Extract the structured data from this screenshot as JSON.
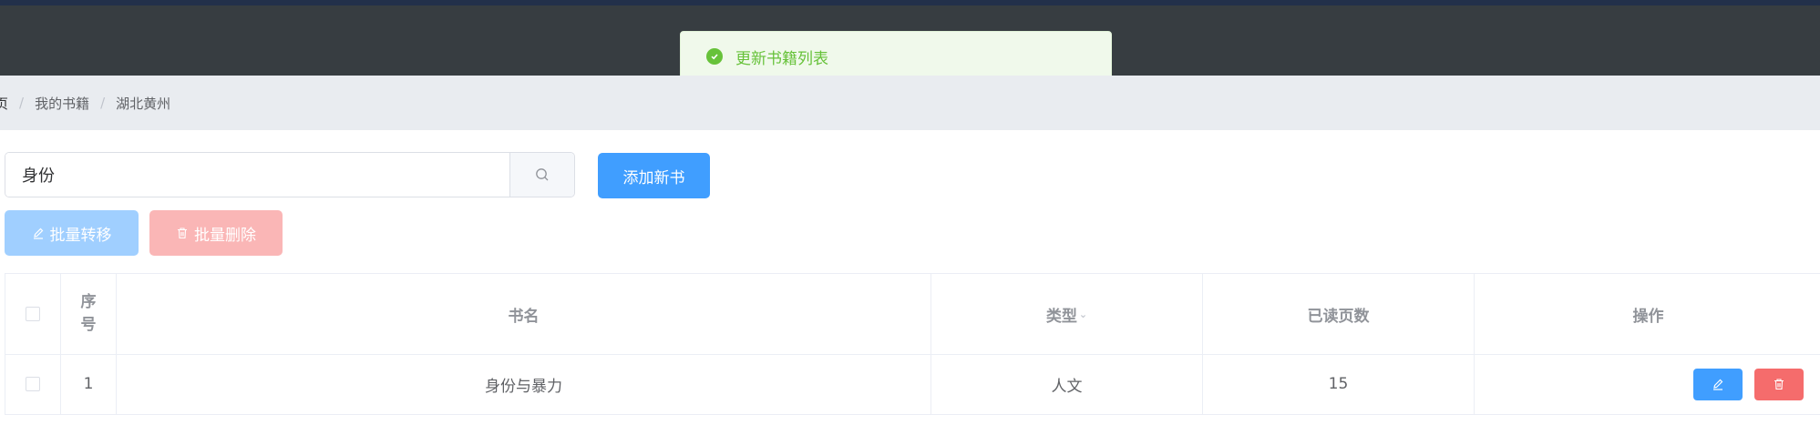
{
  "toast": {
    "message": "更新书籍列表",
    "icon": "check-circle-icon"
  },
  "breadcrumb": {
    "items": [
      "页",
      "我的书籍",
      "湖北黄州"
    ],
    "separator": "/"
  },
  "search": {
    "value": "身份",
    "icon": "search-icon"
  },
  "buttons": {
    "add": "添加新书",
    "batch_move": "批量转移",
    "batch_delete": "批量删除"
  },
  "table": {
    "headers": {
      "index_line1": "序",
      "index_line2": "号",
      "title": "书名",
      "type": "类型",
      "pages_read": "已读页数",
      "actions": "操作"
    },
    "rows": [
      {
        "index": "1",
        "title": "身份与暴力",
        "type": "人文",
        "pages_read": "15"
      }
    ]
  },
  "colors": {
    "primary": "#409eff",
    "danger": "#f56c6c",
    "success": "#67c23a",
    "topbar": "#373d41"
  }
}
